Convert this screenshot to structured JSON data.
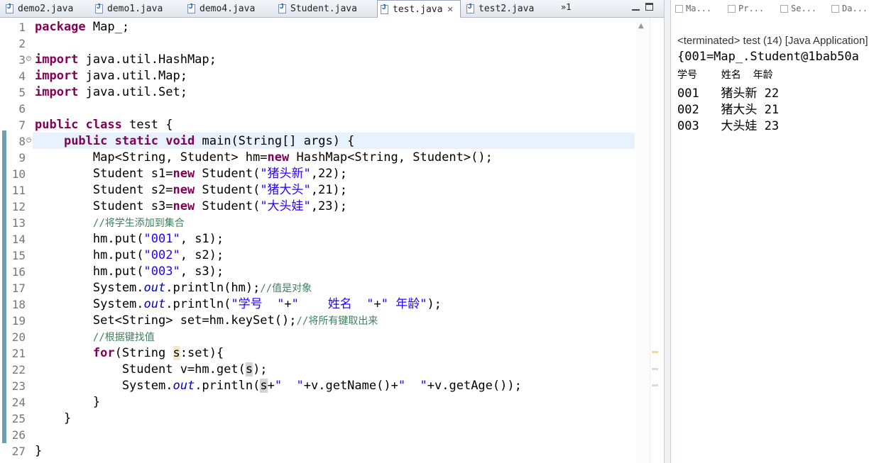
{
  "editor": {
    "tabs": [
      {
        "label": "demo2.java",
        "active": false
      },
      {
        "label": "demo1.java",
        "active": false
      },
      {
        "label": "demo4.java",
        "active": false
      },
      {
        "label": "Student.java",
        "active": false
      },
      {
        "label": "test.java",
        "active": true
      },
      {
        "label": "test2.java",
        "active": false
      }
    ],
    "overflow_label": "»1",
    "line_numbers": [
      "1",
      "2",
      "3",
      "4",
      "5",
      "6",
      "7",
      "8",
      "9",
      "10",
      "11",
      "12",
      "13",
      "14",
      "15",
      "16",
      "17",
      "18",
      "19",
      "20",
      "21",
      "22",
      "23",
      "24",
      "25",
      "26",
      "27"
    ]
  },
  "views": {
    "tabs": [
      {
        "label": "Ma...",
        "icon": "markers-icon"
      },
      {
        "label": "Pr...",
        "icon": "properties-icon"
      },
      {
        "label": "Se...",
        "icon": "servers-icon"
      },
      {
        "label": "Da...",
        "icon": "data-source-icon"
      }
    ]
  },
  "console": {
    "header": "<terminated> test (14) [Java Application]",
    "lines": [
      "{001=Map_.Student@1bab50a",
      "学号    姓名  年龄",
      "001   猪头新 22",
      "002   猪大头 21",
      "003   大头娃 23"
    ]
  }
}
